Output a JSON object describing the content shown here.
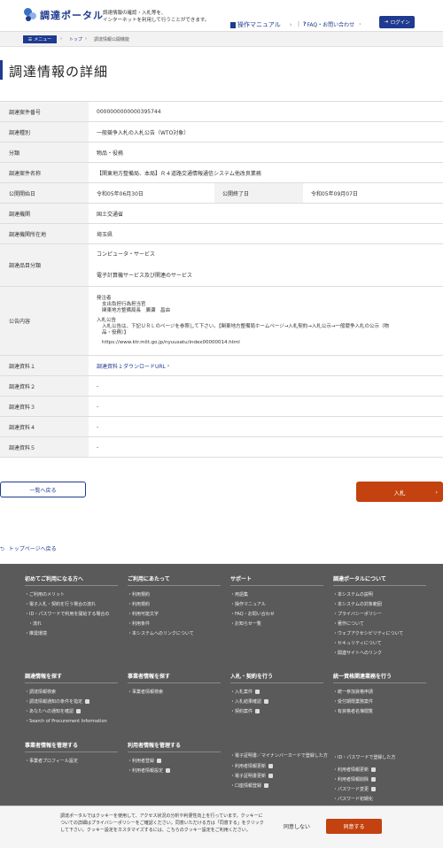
{
  "header": {
    "logo": "調達ポータル",
    "tagline1": "調達情報の確認・入札等を、",
    "tagline2": "インターネットを利用して行うことができます。",
    "manual": "操作マニュアル",
    "faq": "FAQ・お問い合わせ",
    "login": "ログイン"
  },
  "breadcrumb": {
    "menu": "メニュー",
    "top": "トップ",
    "current": "調達情報公開機能"
  },
  "page_title": "調達情報の詳細",
  "details": {
    "case_no_label": "調達案件番号",
    "case_no": "0000000000000395744",
    "type_label": "調達種別",
    "type": "一般競争入札の入札公告（WTO対象）",
    "category_label": "分類",
    "category": "物品・役務",
    "name_label": "調達案件名称",
    "name": "【関東地方整備局、本局】Ｒ４道路交通情報通信システム他改良業務",
    "start_label": "公開開始日",
    "start": "令和05年06月30日",
    "end_label": "公開終了日",
    "end": "令和05年09月07日",
    "agency_label": "調達機関",
    "agency": "国土交通省",
    "location_label": "調達機関所在地",
    "location": "埼玉県",
    "items_label": "調達品目分類",
    "item1": "コンピュータ・サービス",
    "item2": "電子計算機サービス及び関連のサービス",
    "notice_label": "公告内容",
    "notice_l1": "発注者",
    "notice_l2": "支出負担行為担当官",
    "notice_l3": "関東地方整備局長　廣瀬　昌由",
    "notice_l4": "入札公告",
    "notice_l5": "入札公告は、下記ＵＲＬのページを参照して下さい。【関東地方整備局ホームページ→入札契約→入札公示→一般競争入札の公示（物",
    "notice_l6": "品・役務）】",
    "notice_url": "https://www.ktr.mlit.go.jp/nyuusatu/index00000014.html",
    "doc1_label": "調達資料１",
    "doc1": "調達資料１ダウンロードURL",
    "doc2_label": "調達資料２",
    "doc2": "-",
    "doc3_label": "調達資料３",
    "doc3": "-",
    "doc4_label": "調達資料４",
    "doc4": "-",
    "doc5_label": "調達資料５",
    "doc5": "-"
  },
  "buttons": {
    "back": "一覧へ戻る",
    "bid": "入札",
    "totop": "トップページへ戻る"
  },
  "footer": {
    "c1": {
      "head": "初めてご利用になる方へ",
      "items": [
        "ご利用のメリット",
        "電子入札・契約を行う場合の流れ",
        "ID・パスワードで利用を開始する場合の",
        "流れ",
        "推奨環境"
      ]
    },
    "c2": {
      "head": "ご利用にあたって",
      "items": [
        "利用規約",
        "利用規約",
        "利用可能文字",
        "利用条件",
        "本システムへのリンクについて"
      ]
    },
    "c3": {
      "head": "サポート",
      "items": [
        "用語集",
        "操作マニュアル",
        "FAQ・お問い合わせ",
        "お知らせ一覧"
      ]
    },
    "c4": {
      "head": "調達ポータルについて",
      "items": [
        "本システムの説明",
        "本システムの対象範囲",
        "プライバシーポリシー",
        "著作について",
        "ウェブアクセシビリティについて",
        "セキュリティについて",
        "関連サイトへのリンク"
      ]
    },
    "c5": {
      "head": "調達情報を探す",
      "items": [
        "調達情報検索",
        "調達情報通知の条件を指定",
        "あなたへの通知を確認",
        "Search of Procurement Information"
      ]
    },
    "c6": {
      "head": "事業者情報を探す",
      "items": [
        "事業者情報検索"
      ]
    },
    "c7": {
      "head": "入札・契約を行う",
      "items": [
        "入札案件",
        "入札結果確認",
        "契約案件"
      ]
    },
    "c8": {
      "head": "統一資格関連業務を行う",
      "items": [
        "統一参加資格申請",
        "受付期限業務案件",
        "有資格者名簿閲覧"
      ]
    },
    "c9": {
      "head": "事業者情報を管理する",
      "items": [
        "事業者プロフィール設定"
      ]
    },
    "c10": {
      "head": "利用者情報を管理する",
      "items": [
        "利用者登録",
        "利用者情報設定"
      ]
    },
    "c11": {
      "head": "電子証明書／マイナンバーカードで登録した方",
      "items": [
        "利用者情報更新",
        "電子証明書更新",
        "口座情報登録"
      ]
    },
    "c12": {
      "head": "ID・パスワードで登録した方",
      "items": [
        "利用者情報更新",
        "利用者情報削除",
        "パスワード変更",
        "パスワード初期化"
      ]
    }
  },
  "cookie": {
    "text": "調達ポータルではクッキーを使用して、アクセス状況の分析や利便性向上を行っています。クッキーについての詳細はプライバシーポリシーをご確認ください。同意いただける方は「同意する」をクリックして下さい。クッキー設定をカスタマイズするには、こちらのクッキー設定をご利用ください。",
    "decline": "同意しない",
    "accept": "同意する"
  }
}
